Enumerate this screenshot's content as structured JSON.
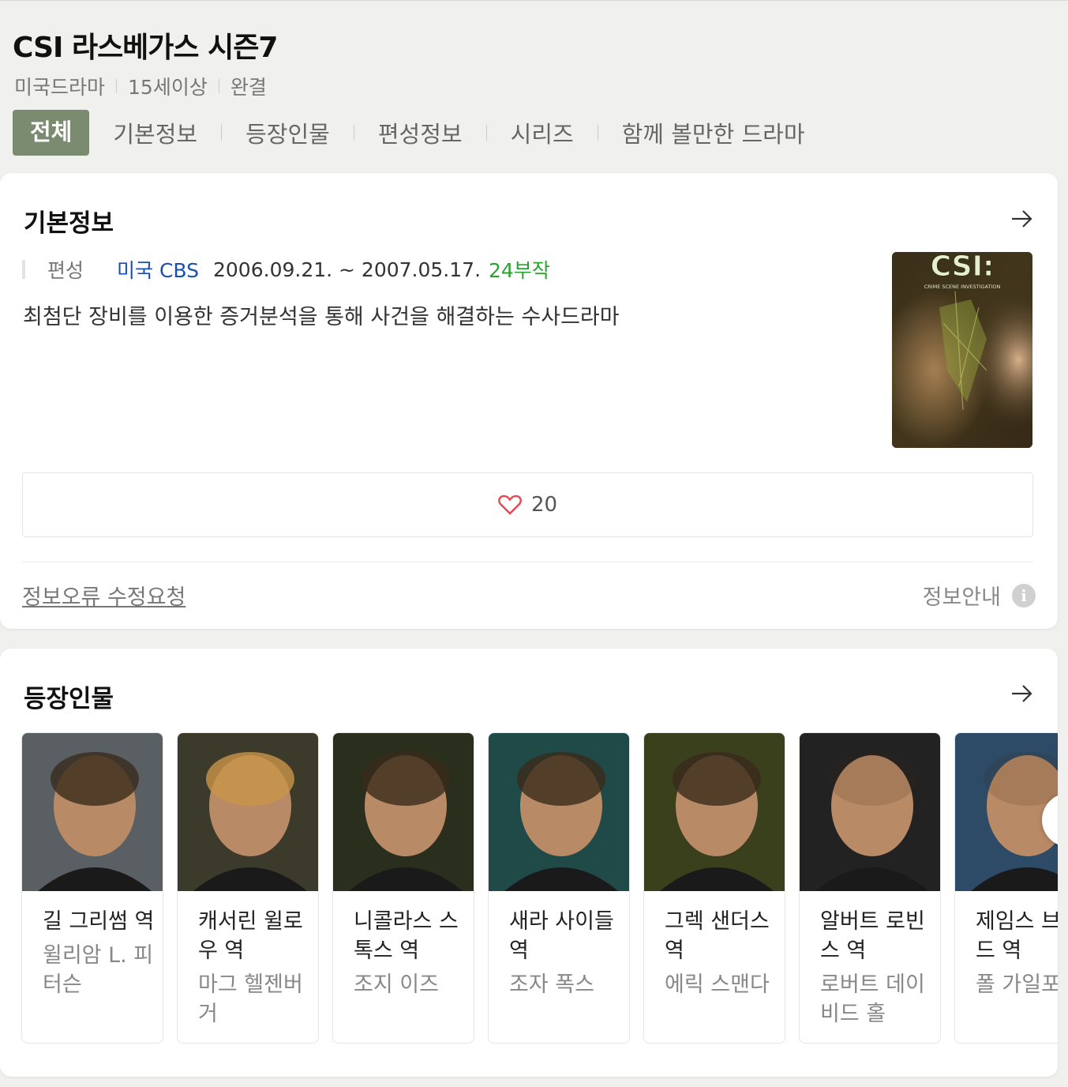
{
  "header": {
    "title": "CSI 라스베가스 시즌7",
    "meta": [
      "미국드라마",
      "15세이상",
      "완결"
    ],
    "tabs": [
      "전체",
      "기본정보",
      "등장인물",
      "편성정보",
      "시리즈",
      "함께 볼만한 드라마"
    ]
  },
  "basic_info": {
    "section_title": "기본정보",
    "schedule_label": "편성",
    "network": "미국 CBS",
    "dates": "2006.09.21. ~ 2007.05.17.",
    "episodes": "24부작",
    "description": "최첨단 장비를 이용한 증거분석을 통해 사건을 해결하는 수사드라마",
    "poster_text": "CSI:",
    "poster_subtext": "CRIME SCENE INVESTIGATION",
    "likes": "20",
    "report_link": "정보오류 수정요청",
    "info_guide": "정보안내",
    "info_icon": "i"
  },
  "cast": {
    "section_title": "등장인물",
    "members": [
      {
        "role": "길 그리썸 역",
        "actor": "윌리암 L. 피터슨",
        "photo_color": "#5a5f63"
      },
      {
        "role": "캐서린 윌로우 역",
        "actor": "마그 헬젠버거",
        "photo_color": "#3c3a2a"
      },
      {
        "role": "니콜라스 스톡스 역",
        "actor": "조지 이즈",
        "photo_color": "#2a2e1c"
      },
      {
        "role": "새라 사이들 역",
        "actor": "조자 폭스",
        "photo_color": "#1f4a48"
      },
      {
        "role": "그렉 샌더스 역",
        "actor": "에릭 스맨다",
        "photo_color": "#3a3f1c"
      },
      {
        "role": "알버트 로빈스 역",
        "actor": "로버트 데이비드 홀",
        "photo_color": "#222222"
      },
      {
        "role": "제임스 브래드 역",
        "actor": "폴 가일포일",
        "photo_color": "#2d4a66"
      }
    ]
  },
  "colors": {
    "active_tab": "#7a8b6f",
    "network": "#1a4fb0",
    "episodes": "#2aa430",
    "heart": "#e8474f"
  }
}
